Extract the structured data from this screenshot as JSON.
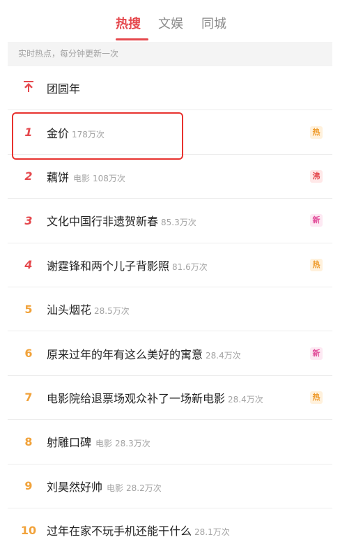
{
  "tabs": [
    {
      "label": "热搜",
      "active": true
    },
    {
      "label": "文娱",
      "active": false
    },
    {
      "label": "同城",
      "active": false
    }
  ],
  "subheader": "实时热点，每分钟更新一次",
  "pinned": {
    "icon": "pin-top-icon",
    "title": "团圆年"
  },
  "items": [
    {
      "rank": "1",
      "title": "金价",
      "tag": "",
      "count": "178万次",
      "badge": "热",
      "badge_type": "hot"
    },
    {
      "rank": "2",
      "title": "藕饼",
      "tag": "电影",
      "count": "108万次",
      "badge": "沸",
      "badge_type": "boil"
    },
    {
      "rank": "3",
      "title": "文化中国行非遗贺新春",
      "tag": "",
      "count": "85.3万次",
      "badge": "新",
      "badge_type": "new"
    },
    {
      "rank": "4",
      "title": "谢霆锋和两个儿子背影照",
      "tag": "",
      "count": "81.6万次",
      "badge": "热",
      "badge_type": "hot"
    },
    {
      "rank": "5",
      "title": "汕头烟花",
      "tag": "",
      "count": "28.5万次",
      "badge": "",
      "badge_type": ""
    },
    {
      "rank": "6",
      "title": "原来过年的年有这么美好的寓意",
      "tag": "",
      "count": "28.4万次",
      "badge": "新",
      "badge_type": "new"
    },
    {
      "rank": "7",
      "title": "电影院给退票场观众补了一场新电影",
      "tag": "",
      "count": "28.4万次",
      "badge": "热",
      "badge_type": "hot"
    },
    {
      "rank": "8",
      "title": "射雕口碑",
      "tag": "电影",
      "count": "28.3万次",
      "badge": "",
      "badge_type": ""
    },
    {
      "rank": "9",
      "title": "刘昊然好帅",
      "tag": "电影",
      "count": "28.2万次",
      "badge": "",
      "badge_type": ""
    },
    {
      "rank": "10",
      "title": "过年在家不玩手机还能干什么",
      "tag": "",
      "count": "28.1万次",
      "badge": "",
      "badge_type": ""
    }
  ],
  "colors": {
    "accent": "#e5484d",
    "rank_orange": "#f1a23a",
    "highlight": "#e8332f"
  }
}
